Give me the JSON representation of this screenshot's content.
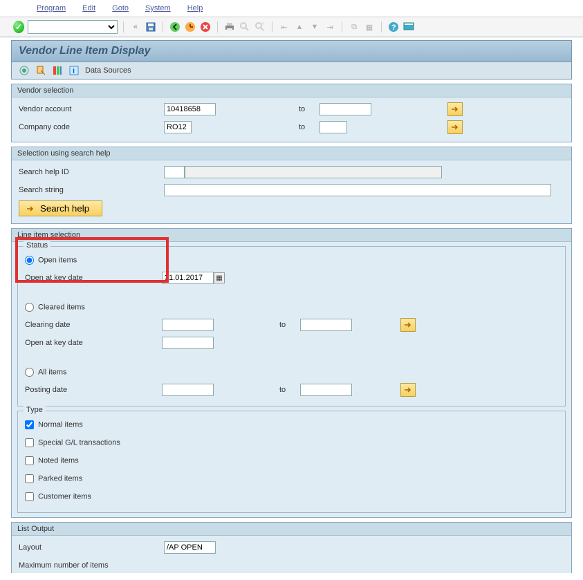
{
  "menu": {
    "program": "Program",
    "edit": "Edit",
    "goto": "Goto",
    "system": "System",
    "help": "Help"
  },
  "title": "Vendor Line Item Display",
  "app_toolbar": {
    "data_sources": "Data Sources"
  },
  "vendor_sel": {
    "title": "Vendor selection",
    "vendor_account_lbl": "Vendor account",
    "vendor_account_val": "10418658",
    "company_code_lbl": "Company code",
    "company_code_val": "RO12",
    "to": "to"
  },
  "search_help": {
    "title": "Selection using search help",
    "id_lbl": "Search help ID",
    "id_val": "",
    "string_lbl": "Search string",
    "string_val": "",
    "btn": "Search help"
  },
  "line_item": {
    "title": "Line item selection",
    "status": {
      "title": "Status",
      "open_items": "Open items",
      "open_at_key_date": "Open at key date",
      "key_date": "31.01.2017",
      "cleared_items": "Cleared items",
      "clearing_date": "Clearing date",
      "all_items": "All items",
      "posting_date": "Posting date",
      "to": "to"
    },
    "type": {
      "title": "Type",
      "normal": "Normal items",
      "special": "Special G/L transactions",
      "noted": "Noted items",
      "parked": "Parked items",
      "customer": "Customer items"
    }
  },
  "list_output": {
    "title": "List Output",
    "layout_lbl": "Layout",
    "layout_val": "/AP OPEN",
    "max_lbl": "Maximum number of items"
  }
}
